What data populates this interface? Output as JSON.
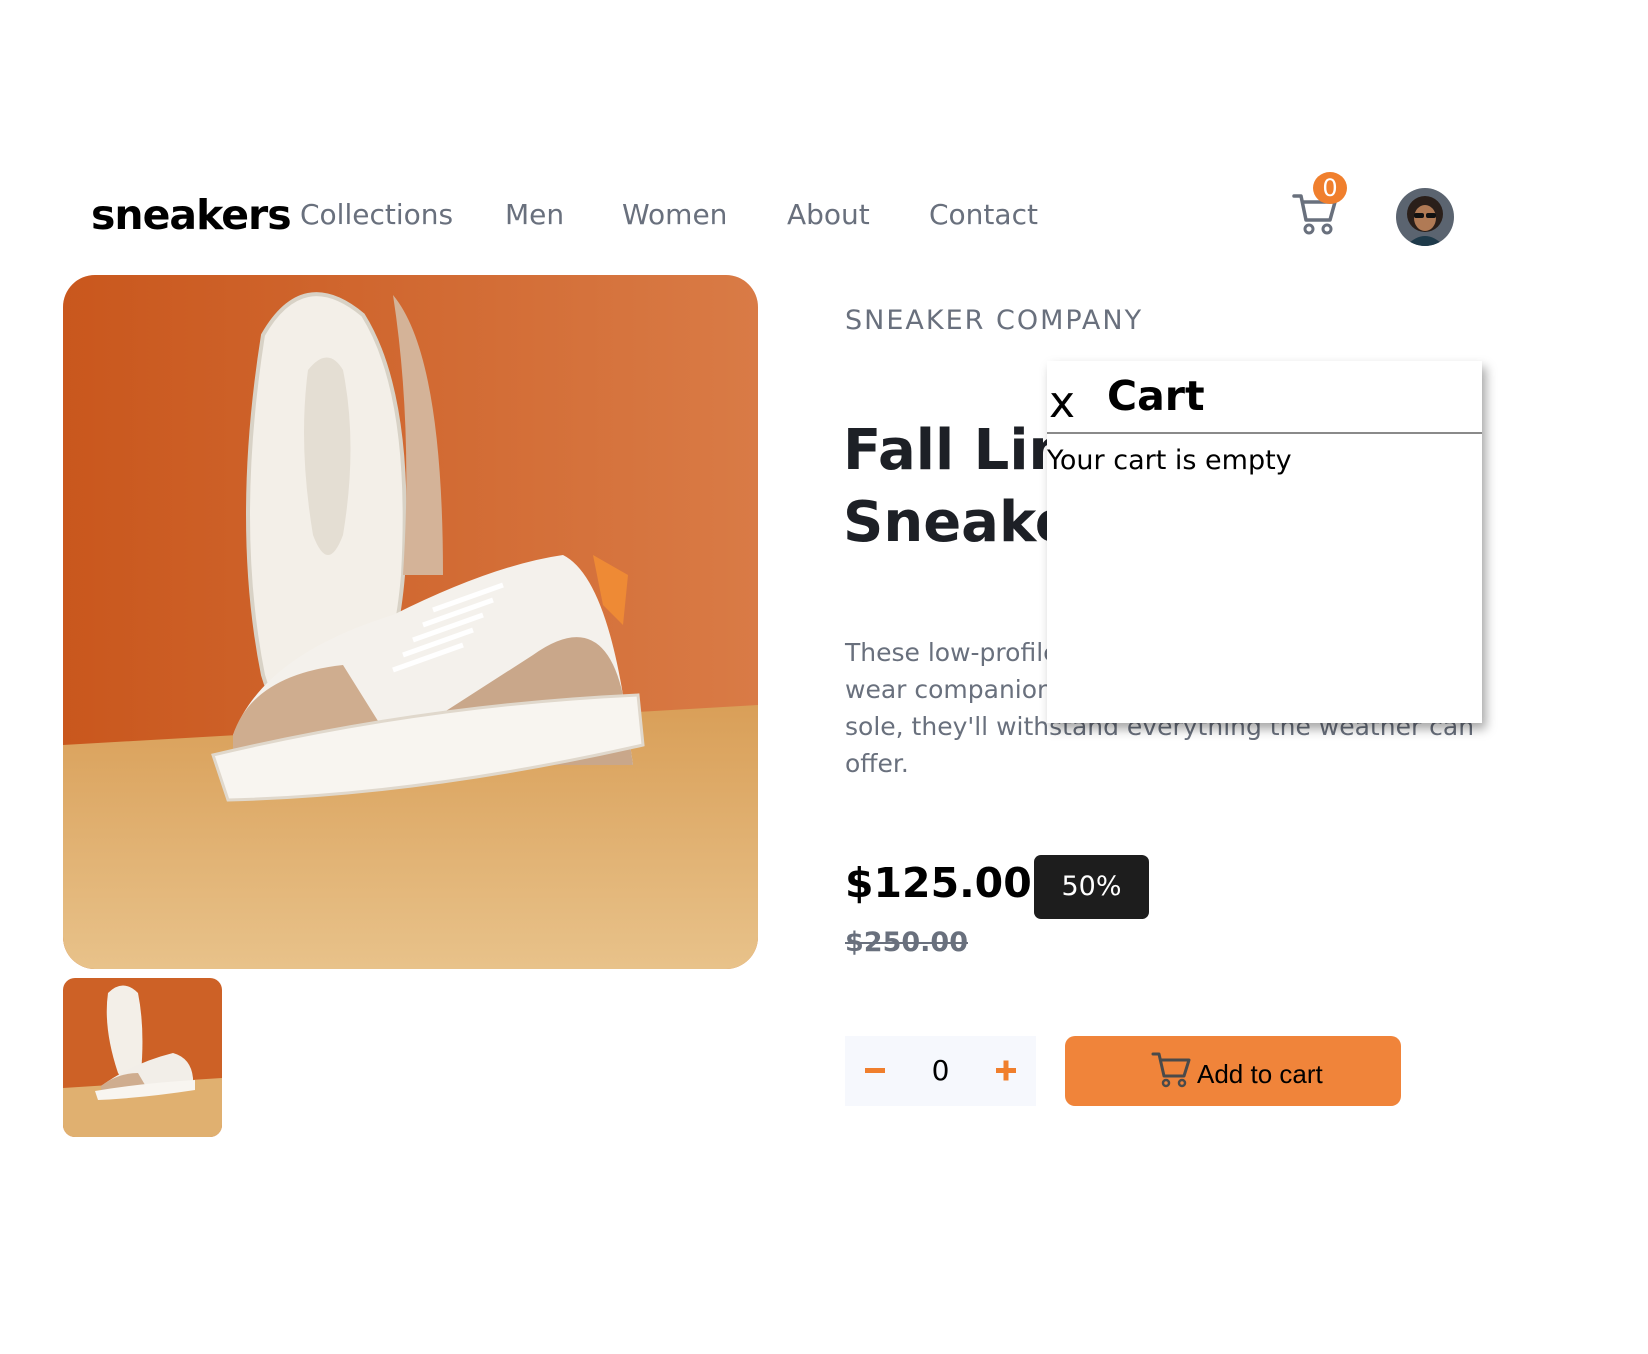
{
  "header": {
    "logo": "sneakers",
    "nav": [
      "Collections",
      "Men",
      "Women",
      "About",
      "Contact"
    ],
    "cart_count": "0",
    "cart_icon": "cart-icon",
    "avatar_icon": "user-avatar"
  },
  "product": {
    "company": "SNEAKER COMPANY",
    "title": "Fall Limited Edition Sneakers",
    "description": "These low-profile sneakers are your perfect casual wear companion. Featuring a durable rubber outer sole, they'll withstand everything the weather can offer.",
    "price": "$125.00",
    "discount": "50%",
    "old_price": "$250.00"
  },
  "purchase": {
    "quantity": "0",
    "minus_icon": "minus-icon",
    "plus_icon": "plus-icon",
    "add_label": "Add to cart"
  },
  "cart": {
    "close_label": "x",
    "title": "Cart",
    "empty_message": "Your cart is empty"
  },
  "colors": {
    "accent": "#f07f2d",
    "dark": "#1d2026",
    "muted": "#69707d"
  }
}
